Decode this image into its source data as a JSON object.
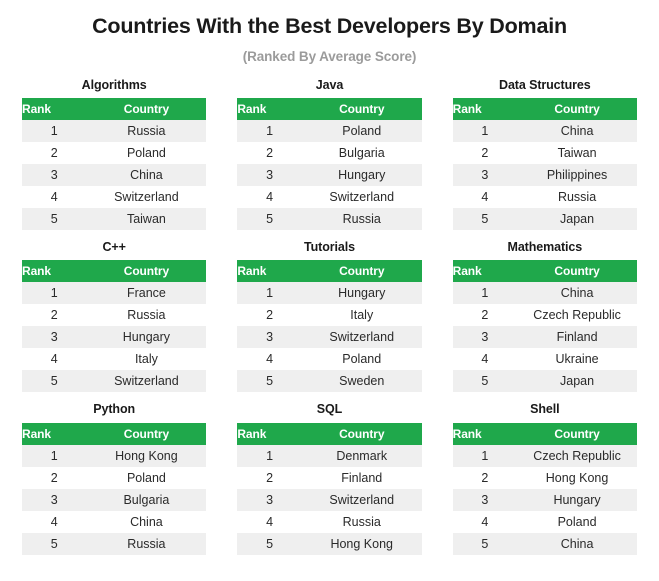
{
  "header": {
    "title": "Countries With the Best Developers By Domain",
    "subtitle": "(Ranked By Average Score)"
  },
  "colors": {
    "header_green": "#1FA84B",
    "row_band": "#EFEFEF",
    "row_alt": "#FFFFFF",
    "title_text": "#1A1A1A",
    "subtitle_text": "#9B9B9B",
    "body_text": "#2A2A2A",
    "header_text": "#FFFFFF",
    "background": "#FFFFFF"
  },
  "columns": {
    "rank": "Rank",
    "country": "Country"
  },
  "chart_data": {
    "type": "table",
    "title": "Countries With the Best Developers By Domain",
    "subtitle": "(Ranked By Average Score)",
    "columns": [
      "Rank",
      "Country"
    ],
    "layout": {
      "rows": 3,
      "cols": 3,
      "grid": true,
      "legend": "none"
    },
    "panels": [
      {
        "title": "Algorithms",
        "rows": [
          {
            "rank": "1",
            "country": "Russia"
          },
          {
            "rank": "2",
            "country": "Poland"
          },
          {
            "rank": "3",
            "country": "China"
          },
          {
            "rank": "4",
            "country": "Switzerland"
          },
          {
            "rank": "5",
            "country": "Taiwan"
          }
        ]
      },
      {
        "title": "Java",
        "rows": [
          {
            "rank": "1",
            "country": "Poland"
          },
          {
            "rank": "2",
            "country": "Bulgaria"
          },
          {
            "rank": "3",
            "country": "Hungary"
          },
          {
            "rank": "4",
            "country": "Switzerland"
          },
          {
            "rank": "5",
            "country": "Russia"
          }
        ]
      },
      {
        "title": "Data Structures",
        "rows": [
          {
            "rank": "1",
            "country": "China"
          },
          {
            "rank": "2",
            "country": "Taiwan"
          },
          {
            "rank": "3",
            "country": "Philippines"
          },
          {
            "rank": "4",
            "country": "Russia"
          },
          {
            "rank": "5",
            "country": "Japan"
          }
        ]
      },
      {
        "title": "C++",
        "rows": [
          {
            "rank": "1",
            "country": "France"
          },
          {
            "rank": "2",
            "country": "Russia"
          },
          {
            "rank": "3",
            "country": "Hungary"
          },
          {
            "rank": "4",
            "country": "Italy"
          },
          {
            "rank": "5",
            "country": "Switzerland"
          }
        ]
      },
      {
        "title": "Tutorials",
        "rows": [
          {
            "rank": "1",
            "country": "Hungary"
          },
          {
            "rank": "2",
            "country": "Italy"
          },
          {
            "rank": "3",
            "country": "Switzerland"
          },
          {
            "rank": "4",
            "country": "Poland"
          },
          {
            "rank": "5",
            "country": "Sweden"
          }
        ]
      },
      {
        "title": "Mathematics",
        "rows": [
          {
            "rank": "1",
            "country": "China"
          },
          {
            "rank": "2",
            "country": "Czech Republic"
          },
          {
            "rank": "3",
            "country": "Finland"
          },
          {
            "rank": "4",
            "country": "Ukraine"
          },
          {
            "rank": "5",
            "country": "Japan"
          }
        ]
      },
      {
        "title": "Python",
        "rows": [
          {
            "rank": "1",
            "country": "Hong Kong"
          },
          {
            "rank": "2",
            "country": "Poland"
          },
          {
            "rank": "3",
            "country": "Bulgaria"
          },
          {
            "rank": "4",
            "country": "China"
          },
          {
            "rank": "5",
            "country": "Russia"
          }
        ]
      },
      {
        "title": "SQL",
        "rows": [
          {
            "rank": "1",
            "country": "Denmark"
          },
          {
            "rank": "2",
            "country": "Finland"
          },
          {
            "rank": "3",
            "country": "Switzerland"
          },
          {
            "rank": "4",
            "country": "Russia"
          },
          {
            "rank": "5",
            "country": "Hong Kong"
          }
        ]
      },
      {
        "title": "Shell",
        "rows": [
          {
            "rank": "1",
            "country": "Czech Republic"
          },
          {
            "rank": "2",
            "country": "Hong Kong"
          },
          {
            "rank": "3",
            "country": "Hungary"
          },
          {
            "rank": "4",
            "country": "Poland"
          },
          {
            "rank": "5",
            "country": "China"
          }
        ]
      }
    ]
  }
}
